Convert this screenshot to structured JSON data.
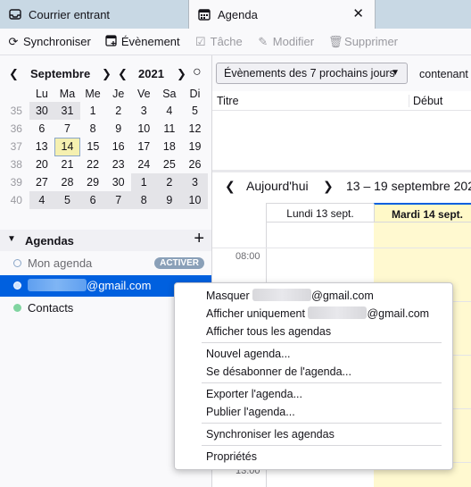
{
  "tabs": [
    {
      "label": "Courrier entrant",
      "icon": "inbox-icon"
    },
    {
      "label": "Agenda",
      "icon": "calendar-icon"
    }
  ],
  "toolbar": {
    "sync": "Synchroniser",
    "event": "Évènement",
    "task": "Tâche",
    "edit": "Modifier",
    "delete": "Supprimer"
  },
  "minimonth": {
    "month": "Septembre",
    "year": "2021",
    "weekdays": [
      "Lu",
      "Ma",
      "Me",
      "Je",
      "Ve",
      "Sa",
      "Di"
    ],
    "weeks": [
      {
        "wk": "35",
        "days": [
          "30",
          "31",
          "1",
          "2",
          "3",
          "4",
          "5"
        ]
      },
      {
        "wk": "36",
        "days": [
          "6",
          "7",
          "8",
          "9",
          "10",
          "11",
          "12"
        ]
      },
      {
        "wk": "37",
        "days": [
          "13",
          "14",
          "15",
          "16",
          "17",
          "18",
          "19"
        ]
      },
      {
        "wk": "38",
        "days": [
          "20",
          "21",
          "22",
          "23",
          "24",
          "25",
          "26"
        ]
      },
      {
        "wk": "39",
        "days": [
          "27",
          "28",
          "29",
          "30",
          "1",
          "2",
          "3"
        ]
      },
      {
        "wk": "40",
        "days": [
          "4",
          "5",
          "6",
          "7",
          "8",
          "9",
          "10"
        ]
      }
    ]
  },
  "agendas": {
    "title": "Agendas",
    "items": [
      {
        "name": "Mon agenda",
        "badge": "ACTIVER"
      },
      {
        "name": "@gmail.com"
      },
      {
        "name": "Contacts"
      }
    ]
  },
  "filter": {
    "select": "Évènements des 7 prochains jours",
    "contains": "contenant"
  },
  "list": {
    "col_title": "Titre",
    "col_start": "Début"
  },
  "nav": {
    "today": "Aujourd'hui",
    "range": "13 – 19 septembre 202"
  },
  "week": {
    "days": [
      "Lundi 13 sept.",
      "Mardi 14 sept."
    ],
    "hours": [
      "08:00",
      "13:00"
    ]
  },
  "menu": {
    "hide": "Masquer",
    "only": "Afficher uniquement",
    "gmail": "@gmail.com",
    "show_all": "Afficher tous les agendas",
    "new": "Nouvel agenda...",
    "unsubscribe": "Se désabonner de l'agenda...",
    "export": "Exporter l'agenda...",
    "publish": "Publier l'agenda...",
    "sync": "Synchroniser les agendas",
    "props": "Propriétés"
  }
}
